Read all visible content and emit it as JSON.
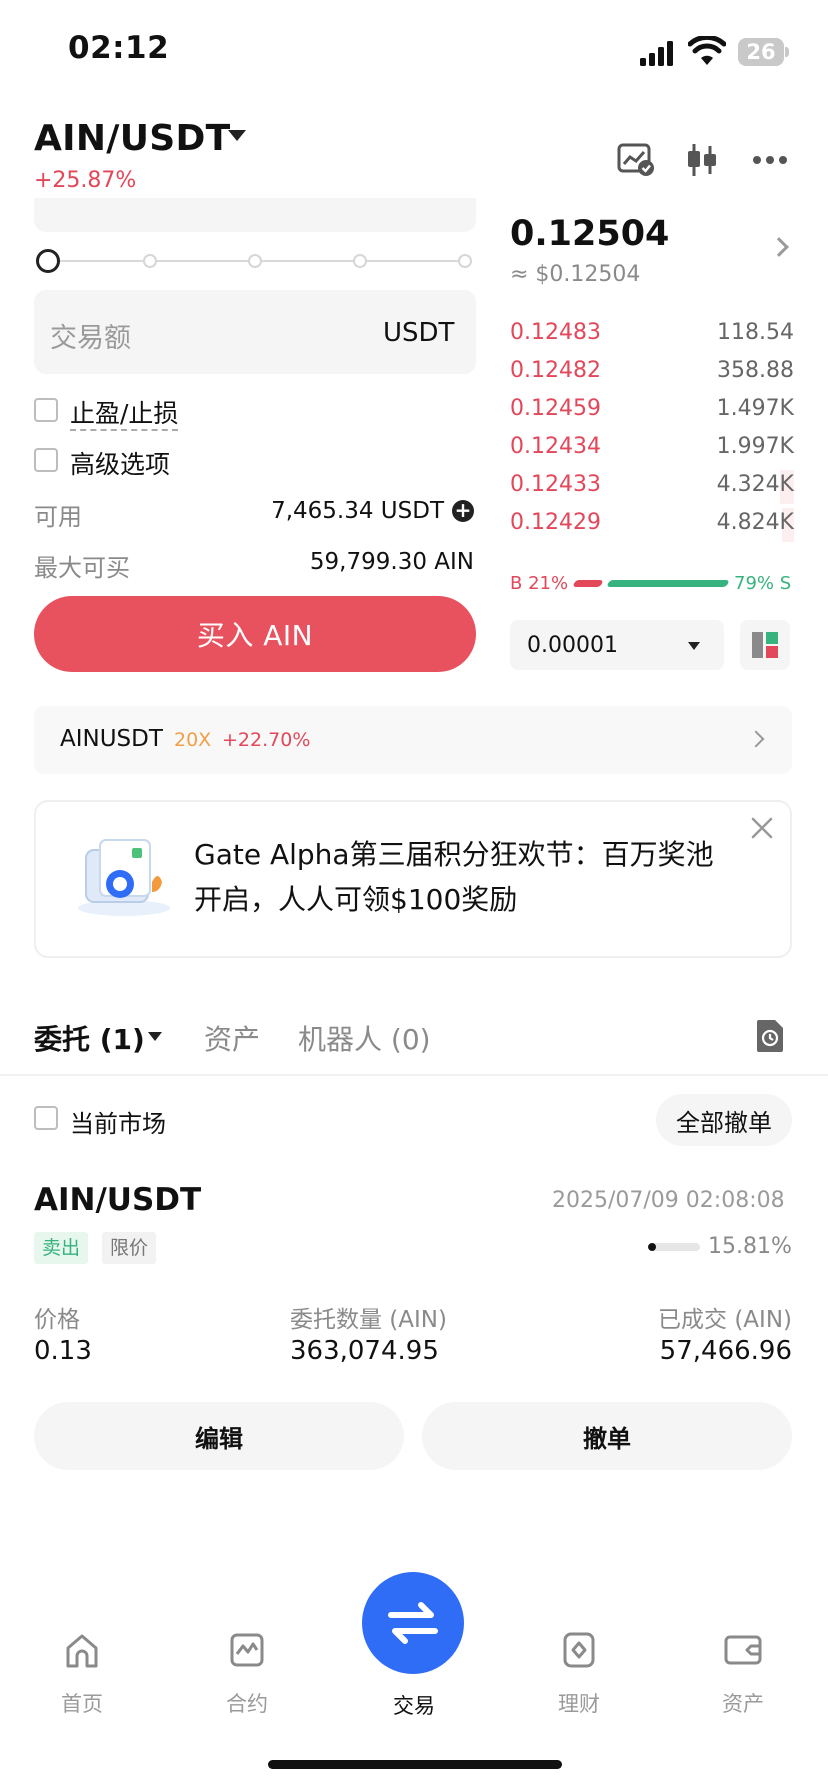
{
  "status_bar": {
    "time": "02:12",
    "battery": "26"
  },
  "header": {
    "pair": "AIN/USDT",
    "change": "+25.87%",
    "icons": [
      "chart-check-icon",
      "candlestick-icon",
      "more-icon"
    ]
  },
  "form": {
    "amount_placeholder": "交易额",
    "amount_unit": "USDT",
    "tp_sl_label": "止盈/止损",
    "advanced_label": "高级选项",
    "available_label": "可用",
    "available_value": "7,465.34 USDT",
    "max_buy_label": "最大可买",
    "max_buy_value": "59,799.30 AIN",
    "buy_button": "买入 AIN"
  },
  "orderbook": {
    "last_price": "0.12504",
    "last_fiat": "≈ $0.12504",
    "asks": [
      {
        "price": "0.12483",
        "size": "118.54"
      },
      {
        "price": "0.12482",
        "size": "358.88"
      },
      {
        "price": "0.12459",
        "size": "1.497K"
      },
      {
        "price": "0.12434",
        "size": "1.997K"
      },
      {
        "price": "0.12433",
        "size": "4.324K"
      },
      {
        "price": "0.12429",
        "size": "4.824K"
      }
    ],
    "buy_ratio_label": "B 21%",
    "sell_ratio_label": "79% S",
    "buy_ratio": 0.21,
    "precision": "0.00001"
  },
  "futures": {
    "symbol": "AINUSDT",
    "leverage": "20X",
    "change": "+22.70%"
  },
  "banner": {
    "text": "Gate Alpha第三届积分狂欢节：百万奖池开启，人人可领$100奖励"
  },
  "tabs": {
    "orders": "委托 (1)",
    "assets": "资产",
    "bots": "机器人 (0)"
  },
  "filter": {
    "current_market": "当前市场",
    "cancel_all": "全部撤单"
  },
  "order": {
    "pair": "AIN/USDT",
    "time": "2025/07/09 02:08:08",
    "side": "卖出",
    "type": "限价",
    "filled_pct": "15.81%",
    "filled_ratio": 0.1581,
    "price_label": "价格",
    "price": "0.13",
    "qty_label": "委托数量 (AIN)",
    "qty": "363,074.95",
    "filled_label": "已成交 (AIN)",
    "filled": "57,466.96",
    "edit": "编辑",
    "cancel": "撤单"
  },
  "nav": {
    "home": "首页",
    "futures": "合约",
    "trade": "交易",
    "earn": "理财",
    "assets": "资产"
  },
  "colors": {
    "sell": "#e2475a",
    "buy": "#36b37e",
    "accent": "#2f6df6",
    "buy_button": "#e8525f"
  }
}
